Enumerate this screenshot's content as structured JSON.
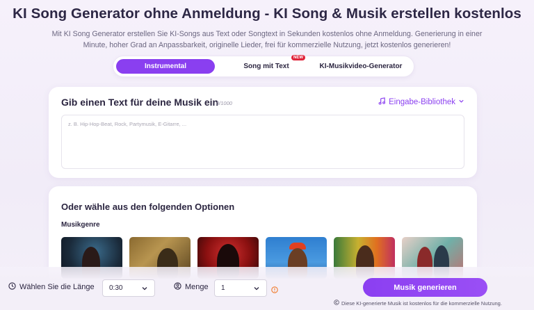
{
  "header": {
    "title": "KI Song Generator ohne Anmeldung - KI Song & Musik erstellen kostenlos",
    "subtitle": "Mit KI Song Generator erstellen Sie KI-Songs aus Text oder Songtext in Sekunden kostenlos ohne Anmeldung. Generierung in einer Minute, hoher Grad an Anpassbarkeit, originelle Lieder, frei für kommerzielle Nutzung, jetzt kostenlos generieren!"
  },
  "tabs": [
    {
      "label": "Instrumental",
      "active": true
    },
    {
      "label": "Song mit Text",
      "badge": "NEW"
    },
    {
      "label": "KI-Musikvideo-Generator"
    }
  ],
  "input_card": {
    "title": "Gib einen Text für deine Musik ein",
    "counter": "0/1000",
    "library_label": "Eingabe-Bibliothek",
    "placeholder": "z. B. Hip-Hop-Beat, Rock, Partymusik, E-Gitarre, ..."
  },
  "options_card": {
    "title": "Oder wähle aus den folgenden Optionen",
    "genre_label": "Musikgenre"
  },
  "bottom": {
    "length_label": "Wählen Sie die Länge",
    "length_value": "0:30",
    "amount_label": "Menge",
    "amount_value": "1",
    "generate_label": "Musik generieren",
    "note": "Diese KI-generierte Musik ist kostenlos für die kommerzielle Nutzung."
  },
  "colors": {
    "accent": "#8a3ff0",
    "badge": "#e0243a",
    "info": "#f07a2a"
  }
}
